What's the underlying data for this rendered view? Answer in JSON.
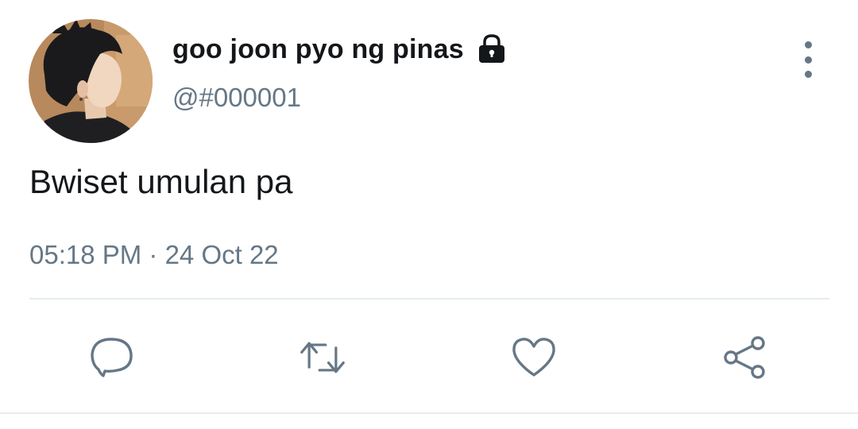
{
  "user": {
    "display_name": "goo joon pyo ng pinas",
    "handle": "@#000001",
    "protected_icon": "lock-icon",
    "avatar_icon": "profile-photo"
  },
  "tweet": {
    "text": "Bwiset umulan pa",
    "timestamp": "05:18 PM · 24 Oct 22"
  },
  "actions": {
    "reply_icon": "speech-bubble-icon",
    "retweet_icon": "retweet-arrows-icon",
    "like_icon": "heart-icon",
    "share_icon": "share-nodes-icon",
    "more_icon": "vertical-ellipsis-icon"
  },
  "colors": {
    "text_primary": "#14171a",
    "text_secondary": "#657786",
    "divider": "#e6ecf0",
    "background": "#ffffff"
  }
}
